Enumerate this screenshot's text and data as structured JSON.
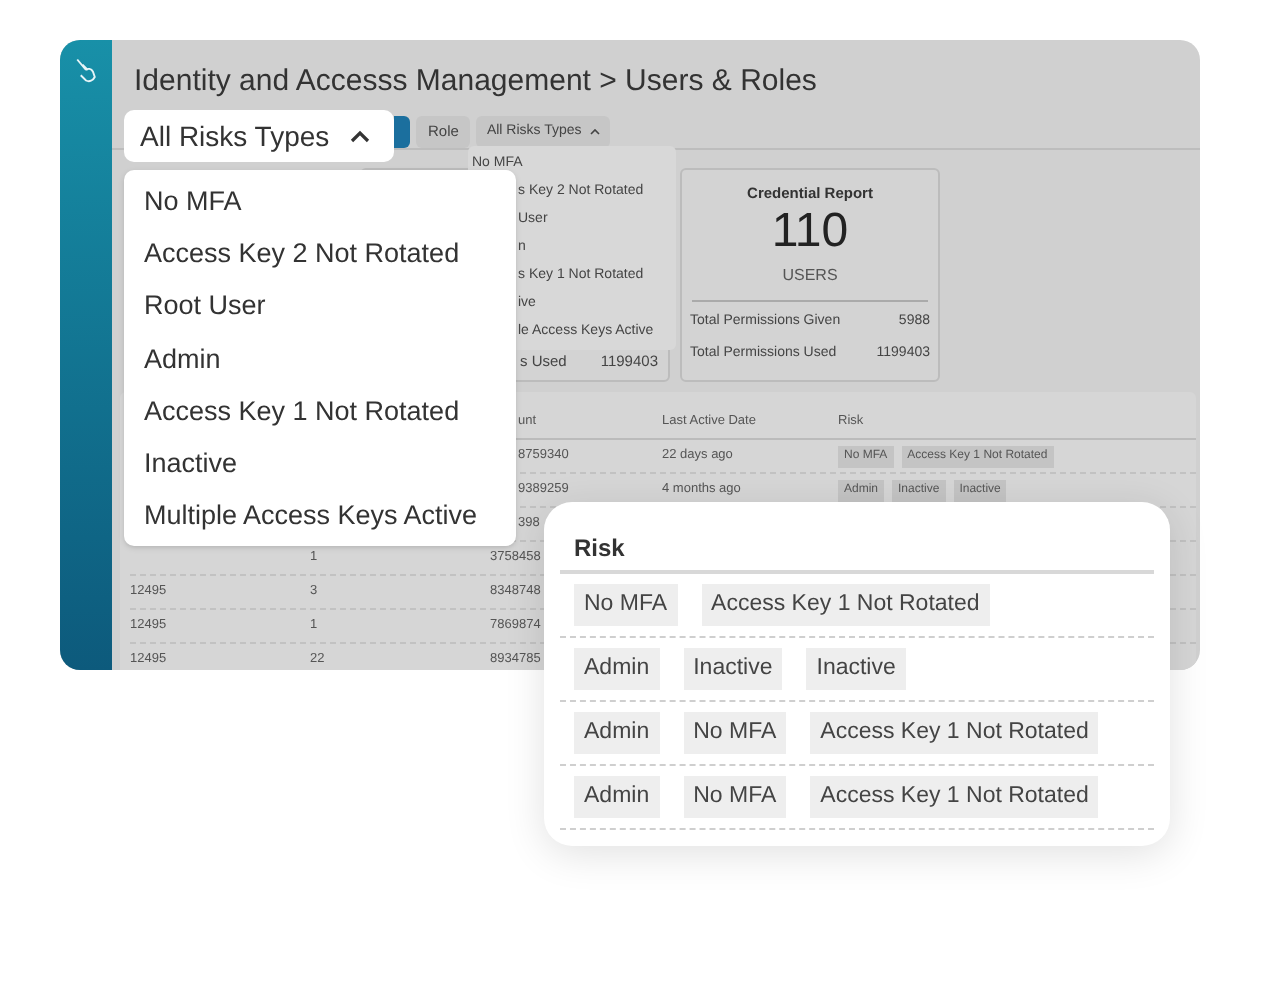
{
  "app": {
    "title": "Identity and Accesss Management > Users & Roles",
    "filters": [
      {
        "kind": "button"
      },
      {
        "kind": "chip",
        "label": "Role"
      },
      {
        "kind": "dropdown",
        "label": "All Risks Types",
        "expanded": true
      }
    ],
    "dropdown_items": [
      "No MFA",
      "s Key 2 Not Rotated",
      "User",
      "n",
      "s Key 1 Not Rotated",
      "ive",
      "le Access Keys Active"
    ],
    "summary_card": {
      "label": "s Used",
      "value": "1199403"
    },
    "credential_report": {
      "title": "Credential Report",
      "count": "110",
      "unit": "USERS",
      "rows": [
        {
          "label": "Total Permissions Given",
          "value": "5988"
        },
        {
          "label": "Total Permissions Used",
          "value": "1199403"
        }
      ]
    },
    "table": {
      "columns": [
        "unt",
        "Last Active Date",
        "Risk"
      ],
      "rows": [
        {
          "column_3": "8759340",
          "column_4": "22 days ago",
          "risks": [
            "No MFA",
            "Access Key 1 Not Rotated"
          ]
        },
        {
          "column_3": "9389259",
          "column_4": "4 months ago",
          "risks": [
            "Admin",
            "Inactive",
            "Inactive"
          ]
        },
        {
          "column_3": "398"
        },
        {
          "column_2": "1",
          "column_3": "3758458"
        },
        {
          "column_1": "12495",
          "column_2": "3",
          "column_3": "8348748"
        },
        {
          "column_1": "12495",
          "column_2": "1",
          "column_3": "7869874"
        },
        {
          "column_1": "12495",
          "column_2": "22",
          "column_3": "8934785"
        }
      ]
    }
  },
  "risk_filter": {
    "label": "All Risks Types",
    "expanded": true,
    "options": [
      "No MFA",
      "Access Key 2 Not Rotated",
      "Root User",
      "Admin",
      "Access Key 1 Not Rotated",
      "Inactive",
      "Multiple Access Keys Active"
    ]
  },
  "risk_card": {
    "header": "Risk",
    "rows": [
      [
        "No MFA",
        "Access Key 1 Not Rotated"
      ],
      [
        "Admin",
        "Inactive",
        "Inactive"
      ],
      [
        "Admin",
        "No MFA",
        "Access Key 1 Not Rotated"
      ],
      [
        "Admin",
        "No MFA",
        "Access Key 1 Not Rotated"
      ]
    ]
  }
}
